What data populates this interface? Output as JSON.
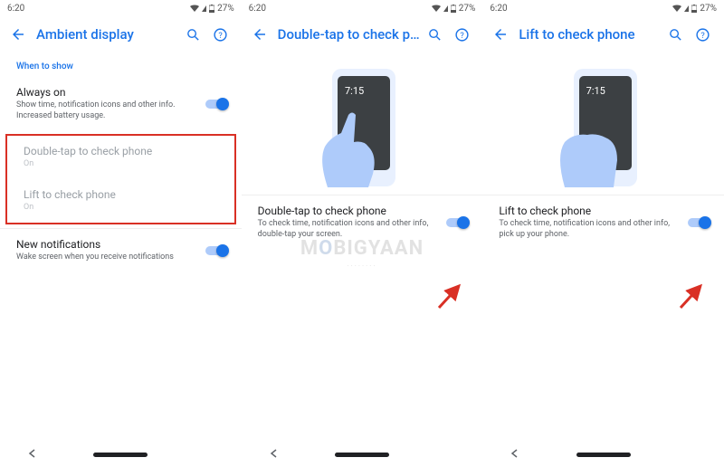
{
  "status": {
    "time": "6:20",
    "battery": "27%"
  },
  "panel1": {
    "title": "Ambient display",
    "section": "When to show",
    "always_on": {
      "title": "Always on",
      "sub": "Show time, notification icons and other info. Increased battery usage."
    },
    "double_tap": {
      "title": "Double-tap to check phone",
      "sub": "On"
    },
    "lift": {
      "title": "Lift to check phone",
      "sub": "On"
    },
    "new_notif": {
      "title": "New notifications",
      "sub": "Wake screen when you receive notifications"
    }
  },
  "panel2": {
    "title": "Double-tap to check ph..",
    "phone_time": "7:15",
    "setting": {
      "title": "Double-tap to check phone",
      "sub": "To check time, notification icons and other info, double-tap your screen."
    }
  },
  "panel3": {
    "title": "Lift to check phone",
    "phone_time": "7:15",
    "setting": {
      "title": "Lift to check phone",
      "sub": "To check time, notification icons and other info, pick up your phone."
    }
  },
  "watermark": "MOBIGYAAN"
}
